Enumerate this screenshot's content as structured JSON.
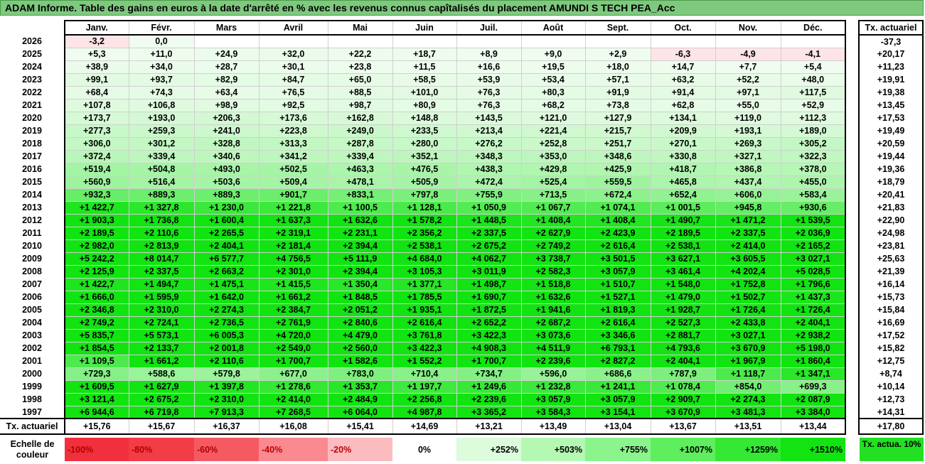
{
  "title": "ADAM Informe. Table des gains en euros à la date d'arrêté en % avec les revenus connus capîtalisés du placement AMUNDI S TECH PEA_Acc",
  "months": [
    "Janv.",
    "Févr.",
    "Mars",
    "Avril",
    "Mai",
    "Juin",
    "Juil.",
    "Août",
    "Sept.",
    "Oct.",
    "Nov.",
    "Déc."
  ],
  "side_header": "Tx. actuariel",
  "rows": [
    {
      "year": "2026",
      "values": [
        "-3,2",
        "0,0",
        "",
        "",
        "",
        "",
        "",
        "",
        "",
        "",
        "",
        ""
      ],
      "rate": "-37,3"
    },
    {
      "year": "2025",
      "values": [
        "+5,3",
        "+11,0",
        "+24,9",
        "+32,0",
        "+22,2",
        "+18,7",
        "+8,9",
        "+9,0",
        "+2,9",
        "-6,3",
        "-4,9",
        "-4,1"
      ],
      "rate": "+20,17"
    },
    {
      "year": "2024",
      "values": [
        "+38,9",
        "+34,0",
        "+28,7",
        "+30,1",
        "+23,8",
        "+11,5",
        "+16,6",
        "+19,5",
        "+18,0",
        "+14,7",
        "+7,7",
        "+5,4"
      ],
      "rate": "+11,23"
    },
    {
      "year": "2023",
      "values": [
        "+99,1",
        "+93,7",
        "+82,9",
        "+84,7",
        "+65,0",
        "+58,5",
        "+53,9",
        "+53,4",
        "+57,1",
        "+63,2",
        "+52,2",
        "+48,0"
      ],
      "rate": "+19,91"
    },
    {
      "year": "2022",
      "values": [
        "+68,4",
        "+74,3",
        "+63,4",
        "+76,5",
        "+88,5",
        "+101,0",
        "+76,3",
        "+80,3",
        "+91,9",
        "+91,4",
        "+97,1",
        "+117,5"
      ],
      "rate": "+19,38"
    },
    {
      "year": "2021",
      "values": [
        "+107,8",
        "+106,8",
        "+98,9",
        "+92,5",
        "+98,7",
        "+80,9",
        "+76,3",
        "+68,2",
        "+73,8",
        "+62,8",
        "+55,0",
        "+52,9"
      ],
      "rate": "+13,45"
    },
    {
      "year": "2020",
      "values": [
        "+173,7",
        "+193,0",
        "+206,3",
        "+173,6",
        "+162,8",
        "+148,8",
        "+143,5",
        "+121,0",
        "+127,9",
        "+134,1",
        "+119,0",
        "+112,3"
      ],
      "rate": "+17,53"
    },
    {
      "year": "2019",
      "values": [
        "+277,3",
        "+259,3",
        "+241,0",
        "+223,8",
        "+249,0",
        "+233,5",
        "+213,4",
        "+221,4",
        "+215,7",
        "+209,9",
        "+193,1",
        "+189,0"
      ],
      "rate": "+19,49"
    },
    {
      "year": "2018",
      "values": [
        "+306,0",
        "+301,2",
        "+328,8",
        "+313,3",
        "+287,8",
        "+280,0",
        "+276,2",
        "+252,8",
        "+251,7",
        "+270,1",
        "+269,3",
        "+305,2"
      ],
      "rate": "+20,59"
    },
    {
      "year": "2017",
      "values": [
        "+372,4",
        "+339,4",
        "+340,6",
        "+341,2",
        "+339,4",
        "+352,1",
        "+348,3",
        "+353,0",
        "+348,6",
        "+330,8",
        "+327,1",
        "+322,3"
      ],
      "rate": "+19,44"
    },
    {
      "year": "2016",
      "values": [
        "+519,4",
        "+504,8",
        "+493,0",
        "+502,5",
        "+463,3",
        "+476,5",
        "+438,3",
        "+429,8",
        "+425,9",
        "+418,7",
        "+386,8",
        "+378,0"
      ],
      "rate": "+19,36"
    },
    {
      "year": "2015",
      "values": [
        "+560,9",
        "+516,4",
        "+503,6",
        "+509,4",
        "+478,1",
        "+505,9",
        "+472,4",
        "+525,4",
        "+559,5",
        "+465,8",
        "+437,4",
        "+455,0"
      ],
      "rate": "+18,79"
    },
    {
      "year": "2014",
      "values": [
        "+932,3",
        "+889,3",
        "+889,3",
        "+901,7",
        "+833,1",
        "+797,8",
        "+755,9",
        "+713,5",
        "+672,4",
        "+652,4",
        "+606,0",
        "+583,4"
      ],
      "rate": "+20,41"
    },
    {
      "year": "2013",
      "values": [
        "+1 422,7",
        "+1 327,8",
        "+1 230,0",
        "+1 221,8",
        "+1 100,5",
        "+1 128,1",
        "+1 050,9",
        "+1 067,7",
        "+1 074,1",
        "+1 001,5",
        "+945,8",
        "+930,6"
      ],
      "rate": "+21,83"
    },
    {
      "year": "2012",
      "values": [
        "+1 903,3",
        "+1 736,8",
        "+1 600,4",
        "+1 637,3",
        "+1 632,6",
        "+1 578,2",
        "+1 448,5",
        "+1 408,4",
        "+1 408,4",
        "+1 490,7",
        "+1 471,2",
        "+1 539,5"
      ],
      "rate": "+22,90"
    },
    {
      "year": "2011",
      "values": [
        "+2 189,5",
        "+2 110,6",
        "+2 265,5",
        "+2 319,1",
        "+2 231,1",
        "+2 356,2",
        "+2 337,5",
        "+2 627,9",
        "+2 423,9",
        "+2 189,5",
        "+2 337,5",
        "+2 036,9"
      ],
      "rate": "+24,98"
    },
    {
      "year": "2010",
      "values": [
        "+2 982,0",
        "+2 813,9",
        "+2 404,1",
        "+2 181,4",
        "+2 394,4",
        "+2 538,1",
        "+2 675,2",
        "+2 749,2",
        "+2 616,4",
        "+2 538,1",
        "+2 414,0",
        "+2 165,2"
      ],
      "rate": "+23,81"
    },
    {
      "year": "2009",
      "values": [
        "+5 242,2",
        "+8 014,7",
        "+6 577,7",
        "+4 756,5",
        "+5 111,9",
        "+4 684,0",
        "+4 062,7",
        "+3 738,7",
        "+3 501,5",
        "+3 627,1",
        "+3 605,5",
        "+3 027,1"
      ],
      "rate": "+25,63"
    },
    {
      "year": "2008",
      "values": [
        "+2 125,9",
        "+2 337,5",
        "+2 663,2",
        "+2 301,0",
        "+2 394,4",
        "+3 105,3",
        "+3 011,9",
        "+2 582,3",
        "+3 057,9",
        "+3 461,4",
        "+4 202,4",
        "+5 028,5"
      ],
      "rate": "+21,39"
    },
    {
      "year": "2007",
      "values": [
        "+1 422,7",
        "+1 494,7",
        "+1 475,1",
        "+1 415,5",
        "+1 350,4",
        "+1 377,1",
        "+1 498,7",
        "+1 518,8",
        "+1 510,7",
        "+1 548,0",
        "+1 752,8",
        "+1 796,6"
      ],
      "rate": "+16,14"
    },
    {
      "year": "2006",
      "values": [
        "+1 666,0",
        "+1 595,9",
        "+1 642,0",
        "+1 661,2",
        "+1 848,5",
        "+1 785,5",
        "+1 690,7",
        "+1 632,6",
        "+1 527,1",
        "+1 479,0",
        "+1 502,7",
        "+1 437,3"
      ],
      "rate": "+15,73"
    },
    {
      "year": "2005",
      "values": [
        "+2 346,8",
        "+2 310,0",
        "+2 274,3",
        "+2 384,7",
        "+2 051,2",
        "+1 935,1",
        "+1 872,5",
        "+1 941,6",
        "+1 819,3",
        "+1 928,7",
        "+1 726,4",
        "+1 726,4"
      ],
      "rate": "+15,84"
    },
    {
      "year": "2004",
      "values": [
        "+2 749,2",
        "+2 724,1",
        "+2 736,5",
        "+2 761,9",
        "+2 840,6",
        "+2 616,4",
        "+2 652,2",
        "+2 687,2",
        "+2 616,4",
        "+2 527,3",
        "+2 433,8",
        "+2 404,1"
      ],
      "rate": "+16,69"
    },
    {
      "year": "2003",
      "values": [
        "+5 835,7",
        "+5 573,1",
        "+6 005,3",
        "+4 720,0",
        "+4 479,0",
        "+3 761,8",
        "+3 422,3",
        "+3 073,6",
        "+3 346,6",
        "+2 881,7",
        "+3 027,1",
        "+2 938,2"
      ],
      "rate": "+17,52"
    },
    {
      "year": "2002",
      "values": [
        "+1 854,5",
        "+2 133,7",
        "+2 001,8",
        "+2 549,0",
        "+2 560,0",
        "+3 422,3",
        "+4 908,3",
        "+4 511,9",
        "+6 793,1",
        "+4 793,6",
        "+3 670,9",
        "+5 198,0"
      ],
      "rate": "+15,82"
    },
    {
      "year": "2001",
      "values": [
        "+1 109,5",
        "+1 661,2",
        "+2 110,6",
        "+1 700,7",
        "+1 582,6",
        "+1 552,2",
        "+1 700,7",
        "+2 239,6",
        "+2 827,2",
        "+2 404,1",
        "+1 967,9",
        "+1 860,4"
      ],
      "rate": "+12,75"
    },
    {
      "year": "2000",
      "values": [
        "+729,3",
        "+588,6",
        "+579,8",
        "+677,0",
        "+783,0",
        "+710,4",
        "+734,7",
        "+596,0",
        "+686,6",
        "+787,9",
        "+1 118,7",
        "+1 347,1"
      ],
      "rate": "+8,74"
    },
    {
      "year": "1999",
      "values": [
        "+1 609,5",
        "+1 627,9",
        "+1 397,8",
        "+1 278,6",
        "+1 353,7",
        "+1 197,7",
        "+1 249,6",
        "+1 232,8",
        "+1 241,1",
        "+1 078,4",
        "+854,0",
        "+699,3"
      ],
      "rate": "+10,14"
    },
    {
      "year": "1998",
      "values": [
        "+3 121,4",
        "+2 675,2",
        "+2 310,0",
        "+2 414,0",
        "+2 484,9",
        "+2 256,8",
        "+2 239,6",
        "+3 057,9",
        "+3 057,9",
        "+2 909,7",
        "+2 274,3",
        "+2 087,9"
      ],
      "rate": "+12,73"
    },
    {
      "year": "1997",
      "values": [
        "+6 944,6",
        "+6 719,8",
        "+7 913,3",
        "+7 268,5",
        "+6 064,0",
        "+4 987,8",
        "+3 365,2",
        "+3 584,3",
        "+3 154,1",
        "+3 670,9",
        "+3 481,3",
        "+3 384,0"
      ],
      "rate": "+14,31"
    }
  ],
  "total_row": {
    "label": "Tx. actuariel",
    "values": [
      "+15,76",
      "+15,67",
      "+16,37",
      "+16,08",
      "+15,41",
      "+14,69",
      "+13,21",
      "+13,49",
      "+13,04",
      "+13,67",
      "+13,51",
      "+13,44"
    ],
    "rate": "+17,80"
  },
  "legend": {
    "label": "Echelle de couleur",
    "items": [
      {
        "text": "-100%",
        "color": "#f0303c"
      },
      {
        "text": "-80%",
        "color": "#f23c46"
      },
      {
        "text": "-60%",
        "color": "#f55a62"
      },
      {
        "text": "-40%",
        "color": "#f88a90"
      },
      {
        "text": "-20%",
        "color": "#fbbcc0"
      },
      {
        "text": "0%",
        "color": "#ffffff"
      },
      {
        "text": "+252%",
        "color": "#dcfcdc"
      },
      {
        "text": "+503%",
        "color": "#b4f8b4"
      },
      {
        "text": "+755%",
        "color": "#8cf48c"
      },
      {
        "text": "+1007%",
        "color": "#5eee5e"
      },
      {
        "text": "+1259%",
        "color": "#34e834"
      },
      {
        "text": "+1510%",
        "color": "#12e412"
      }
    ],
    "side_label": "Tx. actua. 10%"
  }
}
